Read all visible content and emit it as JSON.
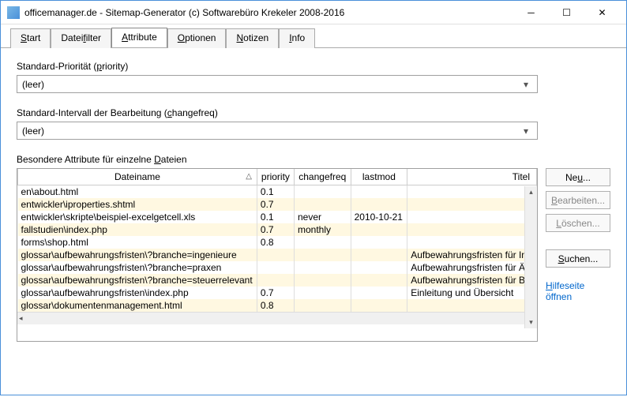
{
  "window": {
    "title": "officemanager.de - Sitemap-Generator (c) Softwarebüro Krekeler 2008-2016"
  },
  "tabs": [
    "Start",
    "Dateifilter",
    "Attribute",
    "Optionen",
    "Notizen",
    "Info"
  ],
  "tabs_underline_idx": [
    0,
    5,
    0,
    0,
    0,
    0
  ],
  "active_tab": 2,
  "priority": {
    "label_pre": "Standard-Priorität (",
    "label_u": "p",
    "label_post": "riority)",
    "value": "(leer)"
  },
  "changefreq": {
    "label_pre": "Standard-Intervall der Bearbeitung (",
    "label_u": "c",
    "label_post": "hangefreq)",
    "value": "(leer)"
  },
  "grid": {
    "caption_pre": "Besondere Attribute für einzelne ",
    "caption_u": "D",
    "caption_post": "ateien",
    "cols": [
      "Dateiname",
      "priority",
      "changefreq",
      "lastmod",
      "Titel"
    ],
    "rows": [
      {
        "file": "en\\about.html",
        "priority": "0.1",
        "changefreq": "",
        "lastmod": "",
        "title": ""
      },
      {
        "file": "entwickler\\iproperties.shtml",
        "priority": "0.7",
        "changefreq": "",
        "lastmod": "",
        "title": ""
      },
      {
        "file": "entwickler\\skripte\\beispiel-excelgetcell.xls",
        "priority": "0.1",
        "changefreq": "never",
        "lastmod": "2010-10-21",
        "title": ""
      },
      {
        "file": "fallstudien\\index.php",
        "priority": "0.7",
        "changefreq": "monthly",
        "lastmod": "",
        "title": ""
      },
      {
        "file": "forms\\shop.html",
        "priority": "0.8",
        "changefreq": "",
        "lastmod": "",
        "title": ""
      },
      {
        "file": "glossar\\aufbewahrungsfristen\\?branche=ingenieure",
        "priority": "",
        "changefreq": "",
        "lastmod": "",
        "title": "Aufbewahrungsfristen für Ingen"
      },
      {
        "file": "glossar\\aufbewahrungsfristen\\?branche=praxen",
        "priority": "",
        "changefreq": "",
        "lastmod": "",
        "title": "Aufbewahrungsfristen für Ärzte"
      },
      {
        "file": "glossar\\aufbewahrungsfristen\\?branche=steuerrelevant",
        "priority": "",
        "changefreq": "",
        "lastmod": "",
        "title": "Aufbewahrungsfristen für Buchh"
      },
      {
        "file": "glossar\\aufbewahrungsfristen\\index.php",
        "priority": "0.7",
        "changefreq": "",
        "lastmod": "",
        "title": "Einleitung und Übersicht"
      },
      {
        "file": "glossar\\dokumentenmanagement.html",
        "priority": "0.8",
        "changefreq": "",
        "lastmod": "",
        "title": ""
      }
    ]
  },
  "buttons": {
    "new_pre": "Ne",
    "new_u": "u",
    "new_post": "...",
    "edit_pre": "",
    "edit_u": "B",
    "edit_post": "earbeiten...",
    "delete_pre": "",
    "delete_u": "L",
    "delete_post": "öschen...",
    "search_pre": "",
    "search_u": "S",
    "search_post": "uchen..."
  },
  "help": {
    "pre": "",
    "u": "H",
    "post": "ilfeseite öffnen"
  }
}
